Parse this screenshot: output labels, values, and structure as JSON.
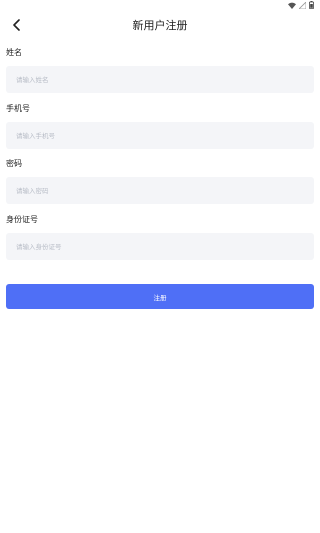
{
  "status_bar": {
    "icons": [
      "wifi-icon",
      "signal-icon",
      "battery-icon"
    ]
  },
  "header": {
    "title": "新用户注册",
    "back_icon": "chevron-left-icon"
  },
  "form": {
    "fields": [
      {
        "label": "姓名",
        "placeholder": "请输入姓名",
        "value": ""
      },
      {
        "label": "手机号",
        "placeholder": "请输入手机号",
        "value": ""
      },
      {
        "label": "密码",
        "placeholder": "请输入密码",
        "value": ""
      },
      {
        "label": "身份证号",
        "placeholder": "请输入身份证号",
        "value": ""
      }
    ],
    "submit_label": "注册"
  },
  "colors": {
    "accent": "#4f6ff6",
    "input_bg": "#f4f5f8",
    "placeholder": "#b7bcc6"
  }
}
